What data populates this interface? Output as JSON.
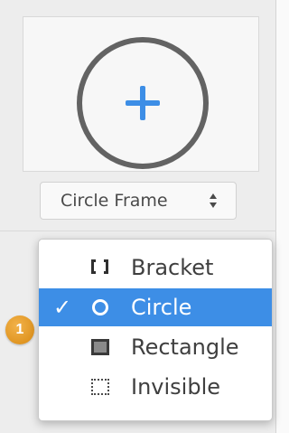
{
  "preview": {
    "icon": "plus-in-circle-icon",
    "accent_color": "#3d8ee6"
  },
  "frame_select": {
    "value": "Circle Frame",
    "icon": "updown-arrows-icon"
  },
  "badge": {
    "count": "1",
    "color": "#e29a22"
  },
  "menu": {
    "selected_color": "#3d8ee6",
    "items": [
      {
        "label": "Bracket",
        "icon": "bracket-icon",
        "selected": false
      },
      {
        "label": "Circle",
        "icon": "circle-outline-icon",
        "selected": true,
        "check": "✓"
      },
      {
        "label": "Rectangle",
        "icon": "filled-square-icon",
        "selected": false
      },
      {
        "label": "Invisible",
        "icon": "dotted-square-icon",
        "selected": false
      }
    ]
  }
}
